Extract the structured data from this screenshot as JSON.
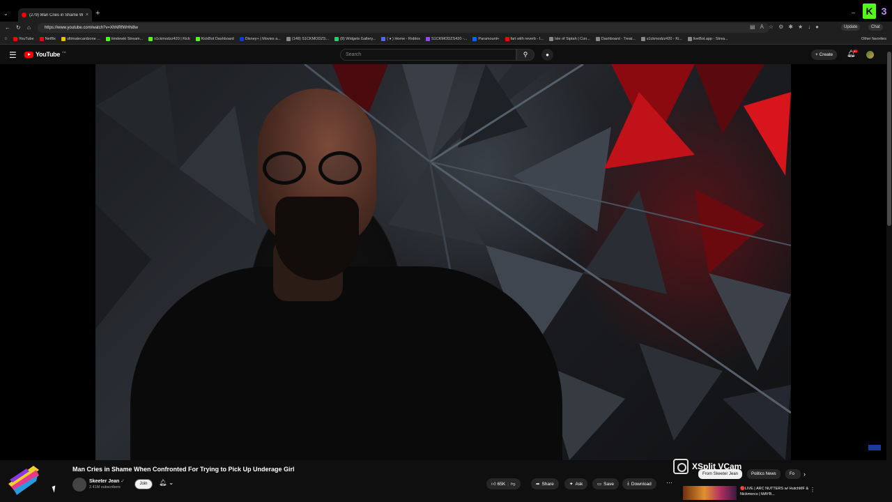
{
  "browser": {
    "tab_title": "(279) Man Cries in Shame Wh",
    "tab_close": "×",
    "new_tab": "+",
    "url": "https://www.youtube.com/watch?v=XhNRfWHhi8w",
    "update_label": "Update",
    "chat_label": "Chat",
    "bookmarks": [
      {
        "label": "YouTube",
        "color": "#ff0000"
      },
      {
        "label": "Netflix",
        "color": "#e50914"
      },
      {
        "label": "ultimatecardzone ...",
        "color": "#f0c000"
      },
      {
        "label": "timdewki Stream...",
        "color": "#53fc18"
      },
      {
        "label": "s1ckmodzz420 | Kick",
        "color": "#53fc18"
      },
      {
        "label": "KickBot Dashboard",
        "color": "#53fc18"
      },
      {
        "label": "Disney+ | Movies a...",
        "color": "#113ccf"
      },
      {
        "label": "(148) S1CKMODZS...",
        "color": "#888888"
      },
      {
        "label": "(8) Widgets Gallery...",
        "color": "#2ecc71"
      },
      {
        "label": "( ♦ ) Home - Roblox",
        "color": "#5865f2"
      },
      {
        "label": "S1CKMODZS420 -...",
        "color": "#9146ff"
      },
      {
        "label": "Paramount+",
        "color": "#0064ff"
      },
      {
        "label": "fart with reverb - I...",
        "color": "#ff0000"
      },
      {
        "label": "Isle of Siptah | Con...",
        "color": "#888888"
      },
      {
        "label": "Dashboard - Treat...",
        "color": "#888888"
      },
      {
        "label": "s1ckmodzz420 - Ki...",
        "color": "#888888"
      },
      {
        "label": "liveBot.app - Strea...",
        "color": "#888888"
      }
    ],
    "other_favorites": "Other favorites"
  },
  "youtube": {
    "wordmark": "YouTube",
    "region": "CA",
    "search_placeholder": "Search",
    "create_label": "Create",
    "notif_count": "9+"
  },
  "video": {
    "title": "Man Cries in Shame When Confronted For Trying to Pick Up Underage Girl",
    "channel": "Skeeter Jean",
    "subscribers": "2.41M subscribers",
    "join_label": "Join",
    "likes": "65K",
    "share_label": "Share",
    "ask_label": "Ask",
    "save_label": "Save",
    "download_label": "Download"
  },
  "overlay": {
    "xsplit_label": "XSplit VCam"
  },
  "chips": [
    "From Skeeter Jean",
    "Politics News",
    "Fo"
  ],
  "recommendation": {
    "title": "🔴LIVE | ARC NUTTERS w/ HutchMF & Nickmercs | MAYB..."
  },
  "colors": {
    "accent": "#ff0000",
    "background": "#0f0f0f"
  }
}
